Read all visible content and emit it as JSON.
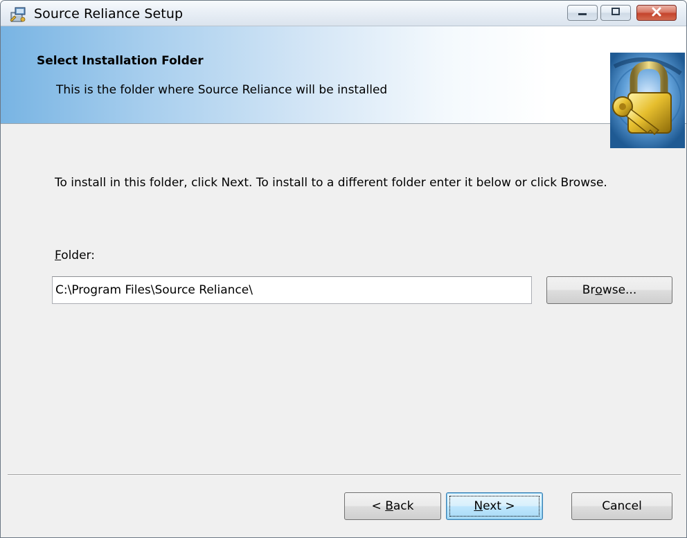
{
  "window": {
    "title": "Source Reliance Setup"
  },
  "banner": {
    "title": "Select Installation Folder",
    "subtitle": "This is the folder where Source Reliance will be installed"
  },
  "content": {
    "instructions": "To install in this folder, click Next. To install to a different folder enter it below or click Browse.",
    "folder_label_accel": "F",
    "folder_label_rest": "older:",
    "folder_value": "C:\\Program Files\\Source Reliance\\"
  },
  "buttons": {
    "browse_pre": "Br",
    "browse_accel": "o",
    "browse_post": "wse...",
    "back_pre": "< ",
    "back_accel": "B",
    "back_post": "ack",
    "next_accel": "N",
    "next_post": "ext >",
    "cancel": "Cancel"
  },
  "colors": {
    "banner_start": "#78b4e3",
    "close_button": "#c4442c",
    "default_button_border": "#3c7fb1"
  },
  "icons": {
    "app": "installer-icon",
    "banner": "padlock-key-icon",
    "minimize": "minimize-icon",
    "maximize": "maximize-icon",
    "close": "close-icon"
  }
}
